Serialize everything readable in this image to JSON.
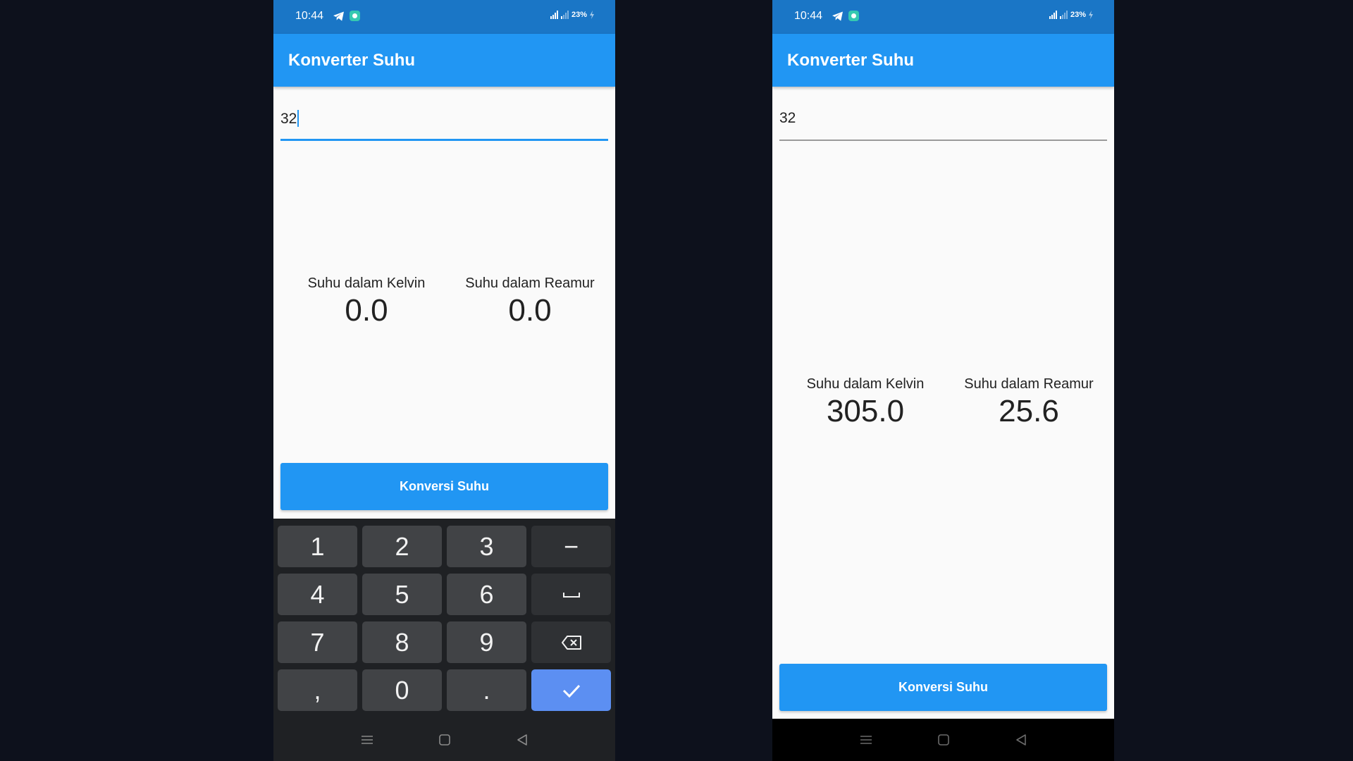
{
  "status": {
    "time": "10:44",
    "battery": "23%"
  },
  "app": {
    "title": "Konverter Suhu"
  },
  "left": {
    "input_value": "32",
    "kelvin_label": "Suhu dalam Kelvin",
    "kelvin_value": "0.0",
    "reamur_label": "Suhu dalam Reamur",
    "reamur_value": "0.0",
    "button_label": "Konversi Suhu",
    "keyboard": {
      "row1": [
        "1",
        "2",
        "3",
        "−"
      ],
      "row2": [
        "4",
        "5",
        "6",
        "space"
      ],
      "row3": [
        "7",
        "8",
        "9",
        "backspace"
      ],
      "row4": [
        ",",
        "0",
        ".",
        "done"
      ]
    }
  },
  "right": {
    "input_value": "32",
    "kelvin_label": "Suhu dalam Kelvin",
    "kelvin_value": "305.0",
    "reamur_label": "Suhu dalam Reamur",
    "reamur_value": "25.6",
    "button_label": "Konversi Suhu"
  },
  "colors": {
    "status_bar": "#1a76c6",
    "app_bar": "#2196f3",
    "accent": "#2196f3",
    "keyboard_bg": "#1f2124",
    "key_bg": "#414346",
    "done_key": "#5c8ff2",
    "page_bg": "#0d111c"
  },
  "icons": [
    "telegram-icon",
    "chat-icon",
    "signal-icon",
    "battery-icon",
    "menu-icon",
    "home-icon",
    "back-icon",
    "backspace-icon",
    "check-icon",
    "space-icon"
  ]
}
